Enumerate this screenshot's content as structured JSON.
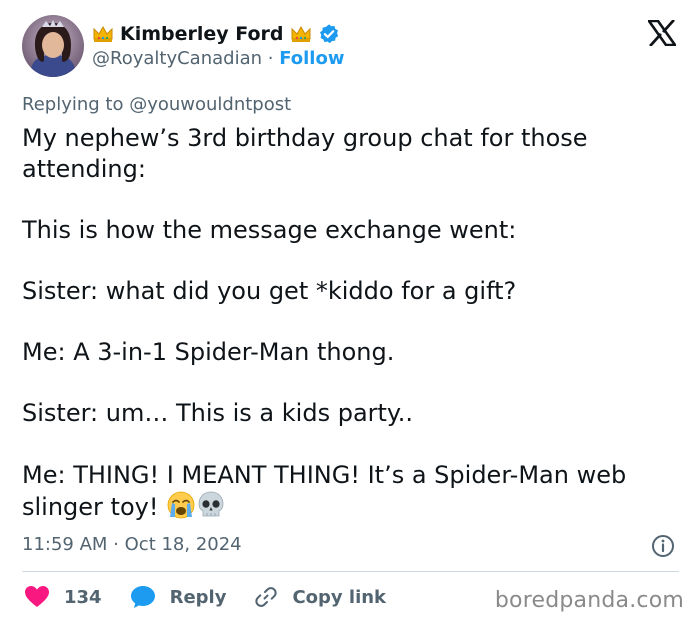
{
  "user": {
    "display_name": "Kimberley Ford",
    "handle": "@RoyaltyCanadian",
    "separator": " · ",
    "follow_label": "Follow",
    "verified_color": "#1d9bf0"
  },
  "reply_context": {
    "label": "Replying to @youwouldntpost"
  },
  "tweet": {
    "lines": [
      "My nephew’s 3rd birthday group chat for those attending:",
      "This is how the message exchange went:",
      "Sister: what did you get *kiddo for a gift?",
      "Me: A 3-in-1 Spider-Man thong.",
      "Sister: um… This is a kids party..",
      "Me: THING! I MEANT THING! It’s a Spider-Man web slinger toy!"
    ],
    "emojis": [
      "crying-face-emoji",
      "skull-emoji"
    ]
  },
  "meta": {
    "time": "11:59 AM",
    "separator": " · ",
    "date": "Oct 18, 2024"
  },
  "actions": {
    "like_count": "134",
    "reply_label": "Reply",
    "copy_label": "Copy link"
  },
  "watermark": "boredpanda.com",
  "icons": {
    "crown": "crown-icon",
    "verified": "verified-badge-icon",
    "x_logo": "x-logo-icon",
    "info": "info-icon",
    "heart": "heart-icon",
    "reply": "reply-bubble-icon",
    "link": "link-icon"
  },
  "colors": {
    "heart": "#f91880",
    "reply": "#1d9bf0",
    "link_blue": "#1d9bf0",
    "muted": "#536471"
  }
}
